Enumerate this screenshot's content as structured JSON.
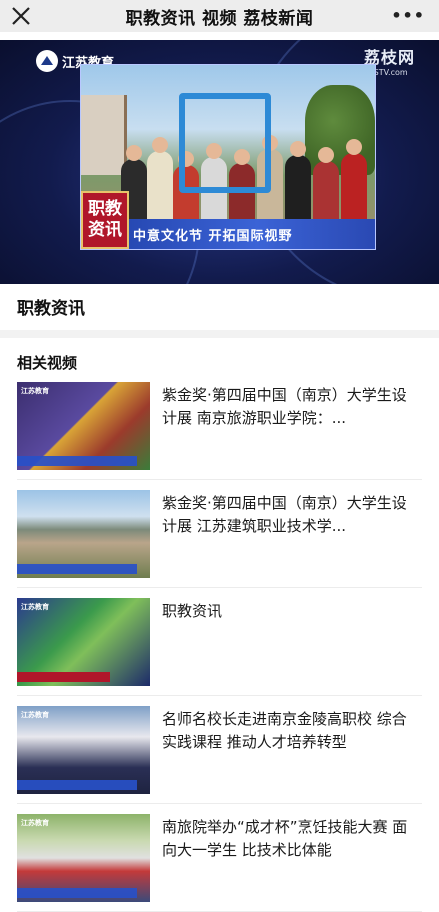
{
  "header": {
    "title": "职教资讯 视频 荔枝新闻",
    "more_label": "•••"
  },
  "banner": {
    "left_logo": "江苏教育",
    "right_logo": "荔枝网",
    "right_logo_sub": "JSTV.com",
    "tag": "职教资讯",
    "caption": "中意文化节  开拓国际视野"
  },
  "section": {
    "title": "职教资讯",
    "related_title": "相关视频"
  },
  "related_videos": [
    {
      "title": "紫金奖·第四届中国（南京）大学生设计展 南京旅游职业学院：..."
    },
    {
      "title": "紫金奖·第四届中国（南京）大学生设计展 江苏建筑职业技术学..."
    },
    {
      "title": "职教资讯"
    },
    {
      "title": "名师名校长走进南京金陵高职校 综合实践课程 推动人才培养转型"
    },
    {
      "title": "南旅院举办“成才杯”烹饪技能大赛 面向大一学生 比技术比体能"
    }
  ],
  "colors": {
    "topbar_bg": "#ededed",
    "banner_bg": "#121b4d",
    "caption_blue": "#2a49b3",
    "tag_red": "#b0162a"
  }
}
